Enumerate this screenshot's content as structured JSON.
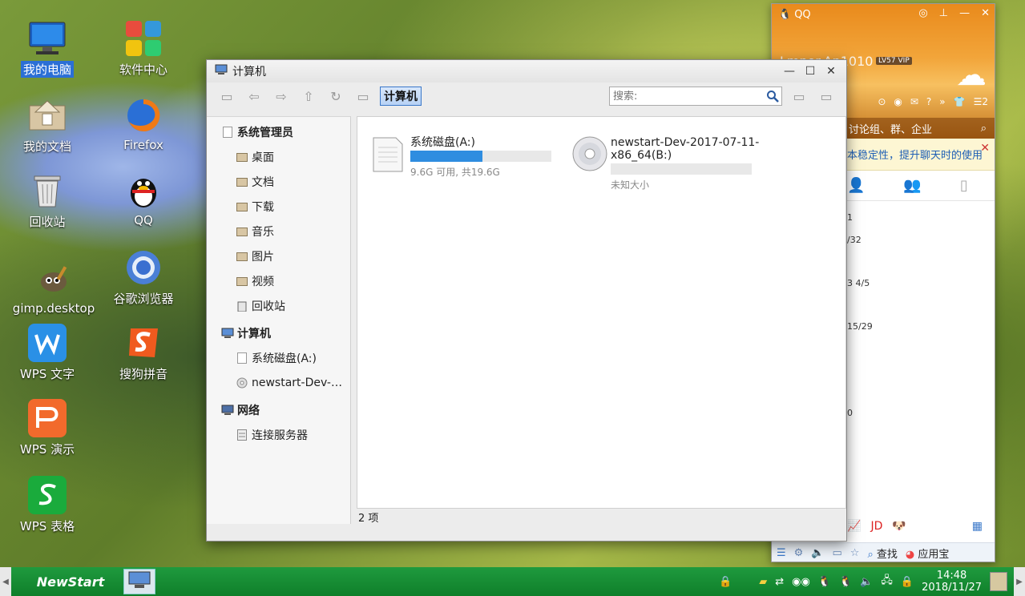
{
  "desktop": {
    "icons": [
      {
        "label": "我的电脑"
      },
      {
        "label": "软件中心"
      },
      {
        "label": "我的文档"
      },
      {
        "label": "Firefox"
      },
      {
        "label": "回收站"
      },
      {
        "label": "QQ"
      },
      {
        "label": "gimp.desktop"
      },
      {
        "label": "谷歌浏览器"
      },
      {
        "label": "WPS 文字"
      },
      {
        "label": "搜狗拼音"
      },
      {
        "label": "WPS 演示"
      },
      {
        "label": "WPS 表格"
      }
    ]
  },
  "window": {
    "title": "计算机",
    "breadcrumb": "计算机",
    "search_placeholder": "搜索:",
    "sidebar": {
      "section_user": "系统管理员",
      "user_items": [
        {
          "label": "桌面"
        },
        {
          "label": "文档"
        },
        {
          "label": "下载"
        },
        {
          "label": "音乐"
        },
        {
          "label": "图片"
        },
        {
          "label": "视频"
        },
        {
          "label": "回收站"
        }
      ],
      "section_computer": "计算机",
      "computer_items": [
        {
          "label": "系统磁盘(A:)"
        },
        {
          "label": "newstart-Dev-…"
        }
      ],
      "section_network": "网络",
      "network_items": [
        {
          "label": "连接服务器"
        }
      ]
    },
    "drives": [
      {
        "name": "系统磁盘(A:)",
        "size": "9.6G 可用, 共19.6G",
        "used_fraction": 0.51
      },
      {
        "name_line1": "newstart-Dev-2017-07-11-",
        "name_line2": "x86_64(B:)",
        "size": "未知大小",
        "used_fraction": 0
      }
    ],
    "status": "2 项"
  },
  "qq": {
    "title": "QQ",
    "nick": "Lmnor.An1010",
    "level": "LV57",
    "vip": "VIP",
    "search_hint": "讨论组、群、企业",
    "notice": "本稳定性，提升聊天时的使用",
    "list_fragments": [
      "1",
      "/32",
      "3  4/5",
      "15/29",
      "0"
    ],
    "bottom_find": "查找",
    "bottom_appbox": "应用宝",
    "app_jd": "JD"
  },
  "taskbar": {
    "start_label": "NewStart",
    "time": "14:48",
    "date": "2018/11/27"
  }
}
